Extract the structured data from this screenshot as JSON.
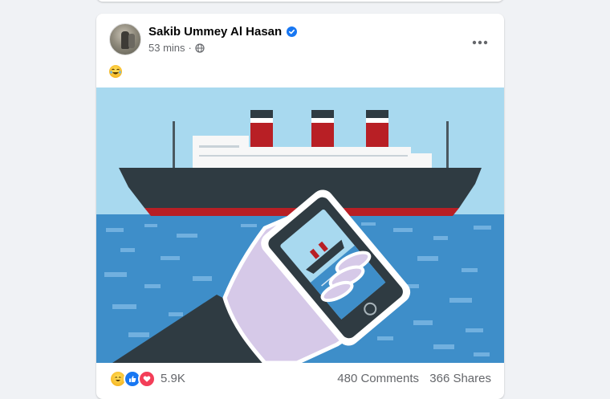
{
  "post": {
    "author_name": "Sakib Ummey Al Hasan",
    "timestamp": "53 mins",
    "separator": "·",
    "audience_icon": "globe-icon",
    "verified_icon": "verified-badge-icon",
    "text_emoji": "laughing-face-emoji",
    "image_alt": "Illustration: a hand holding a phone photographing a steamship at sea"
  },
  "reactions": {
    "icons": [
      "haha-icon",
      "like-icon",
      "love-icon"
    ],
    "count": "5.9K",
    "comments": "480 Comments",
    "shares": "366 Shares"
  },
  "colors": {
    "brand_blue": "#1877f2",
    "sky": "#a8d9ef",
    "sea": "#3e8ec9",
    "hull": "#2f3b42",
    "funnel_red": "#b81f25",
    "hand": "#d6c9e8"
  }
}
